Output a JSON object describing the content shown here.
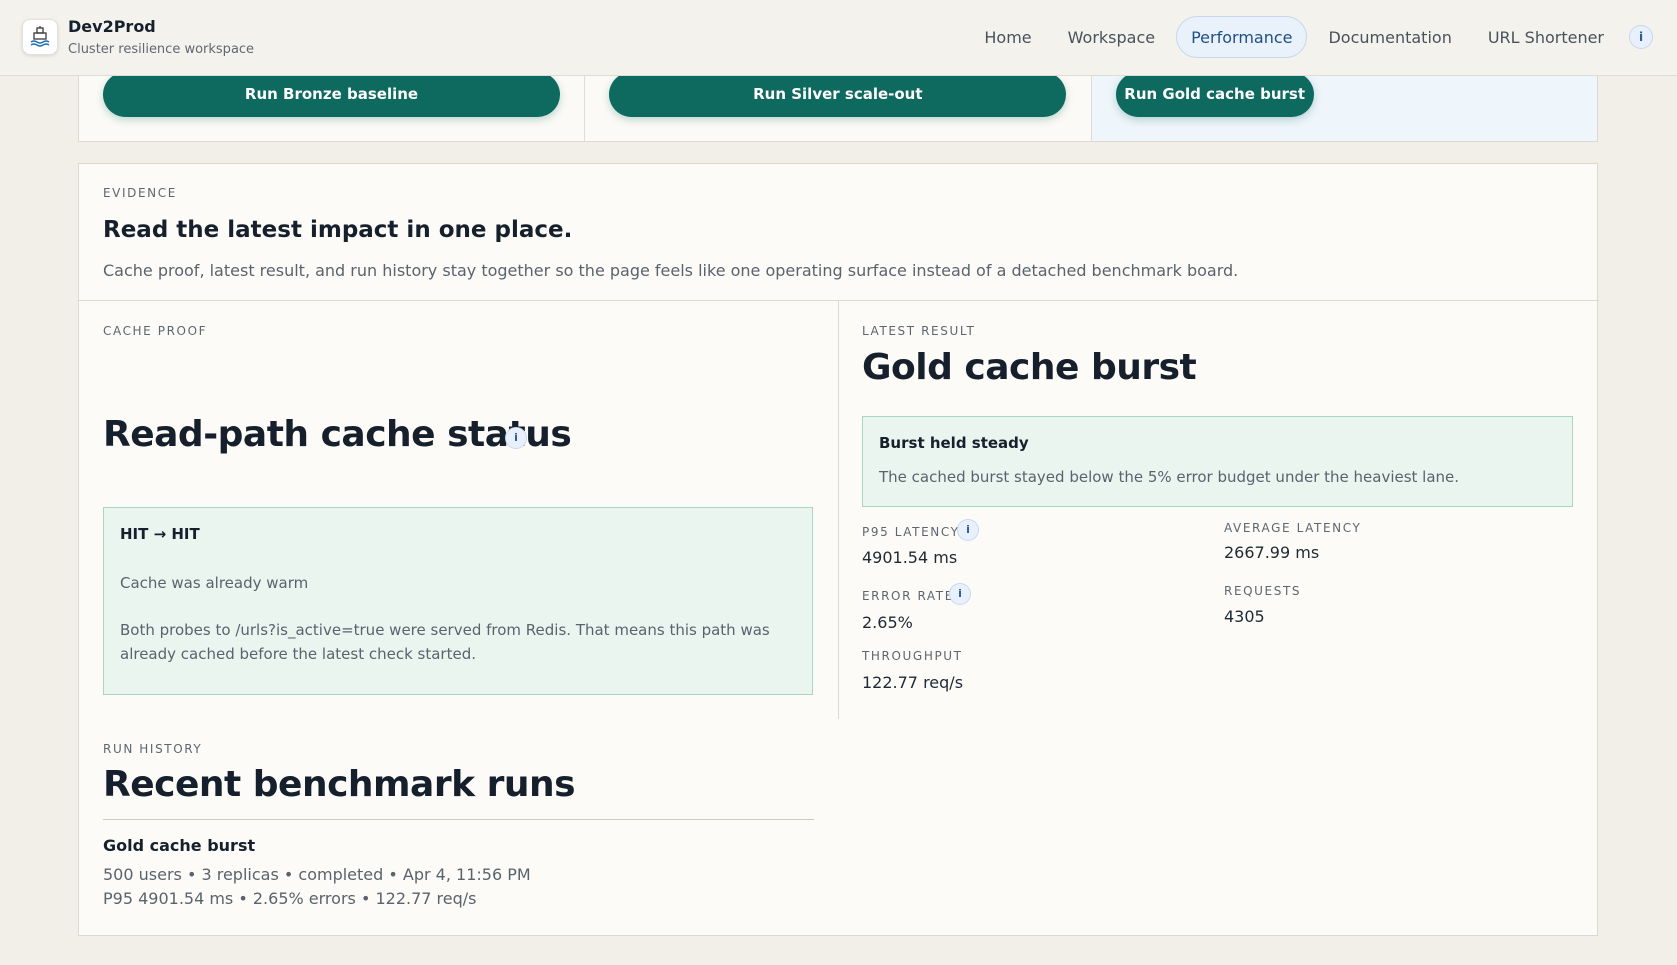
{
  "app": {
    "name": "Dev2Prod",
    "subtitle": "Cluster resilience workspace",
    "logo_icon": "ship-wheel-icon"
  },
  "nav": {
    "items": [
      {
        "label": "Home",
        "active": false
      },
      {
        "label": "Workspace",
        "active": false
      },
      {
        "label": "Performance",
        "active": true
      },
      {
        "label": "Documentation",
        "active": false
      },
      {
        "label": "URL Shortener",
        "active": false
      }
    ],
    "info_label": "i"
  },
  "runs": {
    "bronze_label": "Run Bronze baseline",
    "silver_label": "Run Silver scale-out",
    "gold_label": "Run Gold cache burst"
  },
  "evidence": {
    "eyebrow": "Evidence",
    "title": "Read the latest impact in one place.",
    "description": "Cache proof, latest result, and run history stay together so the page feels like one operating surface instead of a detached benchmark board."
  },
  "cache_proof": {
    "eyebrow": "Cache proof",
    "title": "Read-path cache status",
    "info_label": "i",
    "status": {
      "head": "HIT → HIT",
      "summary": "Cache was already warm",
      "body": "Both probes to /urls?is_active=true were served from Redis. That means this path was already cached before the latest check started."
    }
  },
  "latest_result": {
    "eyebrow": "Latest result",
    "title": "Gold cache burst",
    "notice": {
      "head": "Burst held steady",
      "body": "The cached burst stayed below the 5% error budget under the heaviest lane."
    },
    "metrics": {
      "p95_label": "P95 Latency",
      "p95_value": "4901.54 ms",
      "avg_label": "Average Latency",
      "avg_value": "2667.99 ms",
      "error_label": "Error Rate",
      "error_value": "2.65%",
      "requests_label": "Requests",
      "requests_value": "4305",
      "throughput_label": "Throughput",
      "throughput_value": "122.77 req/s",
      "info_label": "i"
    }
  },
  "run_history": {
    "eyebrow": "Run history",
    "title": "Recent benchmark runs",
    "items": [
      {
        "name": "Gold cache burst",
        "meta": "500 users • 3 replicas • completed • Apr 4, 11:56 PM",
        "stats": "P95 4901.54 ms • 2.65% errors • 122.77 req/s"
      }
    ]
  },
  "colors": {
    "accent": "#0e6a5e",
    "nav_active_bg": "#e9f1fb",
    "success_bg": "#eaf5f0",
    "success_border": "#a9d6c3"
  }
}
